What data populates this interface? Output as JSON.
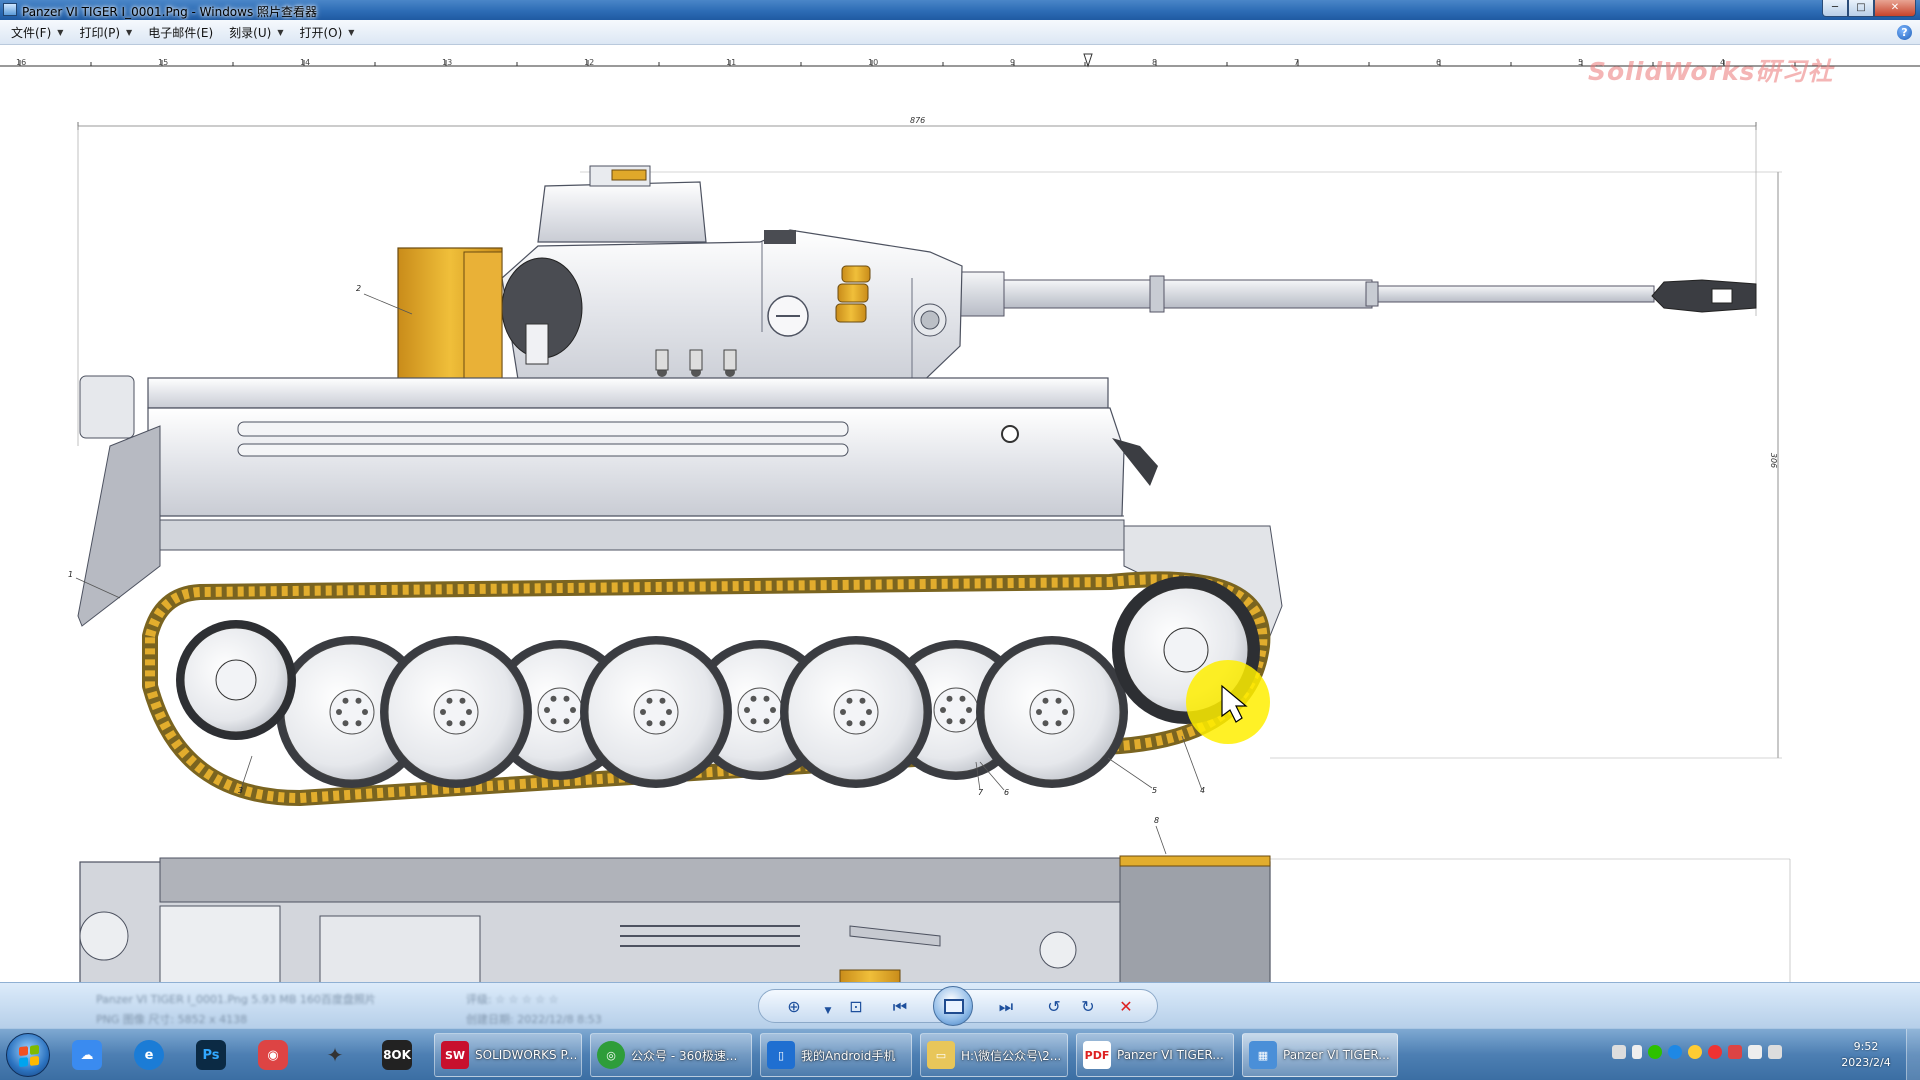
{
  "window": {
    "title": "Panzer VI TIGER I_0001.Png - Windows 照片查看器",
    "minimize": "─",
    "maximize": "□",
    "close": "✕"
  },
  "menu": {
    "items": [
      {
        "label": "文件(F)"
      },
      {
        "label": "打印(P)"
      },
      {
        "label": "电子邮件(E)"
      },
      {
        "label": "刻录(U)"
      },
      {
        "label": "打开(O)"
      }
    ],
    "help": "?"
  },
  "image": {
    "watermark": "SolidWorks研习社",
    "ruler_labels": [
      "16",
      "15",
      "14",
      "13",
      "12",
      "11",
      "10",
      "9",
      "8",
      "7",
      "6",
      "5",
      "4"
    ],
    "dimension_width": "876",
    "dimension_height": "306",
    "callouts": [
      "1",
      "2",
      "3",
      "4",
      "5",
      "6",
      "7",
      "8"
    ],
    "colors": {
      "hull": "#e4e6ea",
      "track": "#d9a521",
      "armor_yellow": "#e0a82a",
      "highlight": "#ffee00"
    }
  },
  "viewer_controls": {
    "info_line1": "Panzer VI TIGER I_0001.Png  5.93 MB  160百度盘照片",
    "info_line2": "PNG 图像    尺寸: 5852 x 4138",
    "info_line3": "评级: ☆ ☆ ☆ ☆ ☆",
    "info_line4": "创建日期: 2022/12/8 8:53",
    "zoom": "⊕",
    "fit": "⊡",
    "previous": "⏮",
    "slideshow": "",
    "next": "⏭",
    "rotate_ccw": "↺",
    "rotate_cw": "↻",
    "delete": "✕"
  },
  "taskbar": {
    "tasks": [
      {
        "label": "SOLIDWORKS P..."
      },
      {
        "label": "公众号 - 360极速..."
      },
      {
        "label": "我的Android手机"
      },
      {
        "label": "H:\\微信公众号\\2..."
      },
      {
        "label": "Panzer VI TIGER..."
      },
      {
        "label": "Panzer VI TIGER..."
      }
    ],
    "clock_time": "9:52",
    "clock_date": "2023/2/4"
  }
}
